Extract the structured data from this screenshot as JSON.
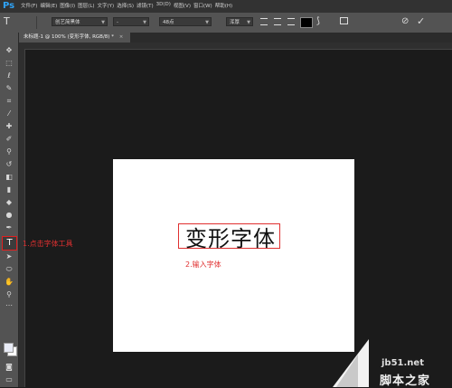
{
  "app": {
    "logo": "Ps"
  },
  "menu": [
    "文件(F)",
    "编辑(E)",
    "图像(I)",
    "图层(L)",
    "文字(Y)",
    "选择(S)",
    "滤镜(T)",
    "3D(D)",
    "视图(V)",
    "窗口(W)",
    "帮助(H)"
  ],
  "options_bar": {
    "tool_icon": "T",
    "font_family": "创艺简黑体",
    "font_style": "-",
    "font_size": "48点",
    "antialias": "浑厚",
    "color": "#000000"
  },
  "document": {
    "tab_label": "未标题-1 @ 100% (变形字体, RGB/8) *",
    "close": "×"
  },
  "canvas": {
    "text": "变形字体"
  },
  "annotations": {
    "step1": "1.点击字体工具",
    "step2": "2.输入字体"
  },
  "watermark": {
    "site": "jb51.net",
    "brand": "脚本之家"
  },
  "colors": {
    "accent_red": "#e03030",
    "canvas_bg": "#ffffff",
    "workspace_bg": "#1b1b1b"
  }
}
